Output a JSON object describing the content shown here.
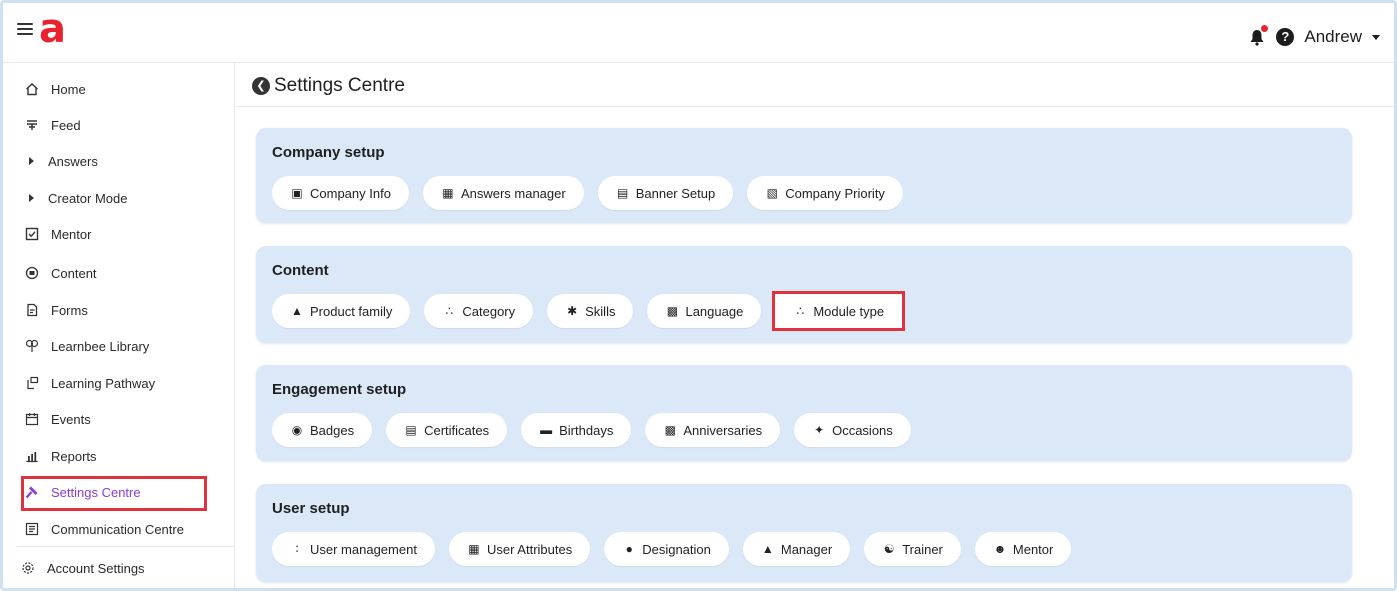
{
  "header": {
    "logo_text": "a",
    "user_name": "Andrew",
    "brand_color": "#e8232f"
  },
  "sidebar": {
    "items": [
      {
        "label": "Home",
        "icon": "home-icon"
      },
      {
        "label": "Feed",
        "icon": "feed-icon"
      },
      {
        "label": "Answers",
        "icon": "chevron-right-icon"
      },
      {
        "label": "Creator Mode",
        "icon": "chevron-right-icon"
      },
      {
        "label": "Mentor",
        "icon": "checkbox-icon"
      },
      {
        "label": "Content",
        "icon": "content-icon"
      },
      {
        "label": "Forms",
        "icon": "forms-icon"
      },
      {
        "label": "Learnbee Library",
        "icon": "library-icon"
      },
      {
        "label": "Learning Pathway",
        "icon": "pathway-icon"
      },
      {
        "label": "Events",
        "icon": "calendar-icon"
      },
      {
        "label": "Reports",
        "icon": "reports-icon"
      },
      {
        "label": "Settings Centre",
        "icon": "hammer-icon",
        "active": true
      },
      {
        "label": "Communication Centre",
        "icon": "communication-icon"
      },
      {
        "label": "Account Settings",
        "icon": "gear-icon"
      }
    ],
    "active_color": "#8a3dd6"
  },
  "page": {
    "back_icon": "back-arrow-icon",
    "title": "Settings Centre"
  },
  "sections": [
    {
      "title": "Company setup",
      "chips": [
        {
          "label": "Company Info",
          "icon": "monitor-icon"
        },
        {
          "label": "Answers manager",
          "icon": "grid-icon"
        },
        {
          "label": "Banner Setup",
          "icon": "banner-icon"
        },
        {
          "label": "Company Priority",
          "icon": "priority-icon"
        }
      ]
    },
    {
      "title": "Content",
      "chips": [
        {
          "label": "Product family",
          "icon": "hierarchy-icon"
        },
        {
          "label": "Category",
          "icon": "category-icon"
        },
        {
          "label": "Skills",
          "icon": "puzzle-icon"
        },
        {
          "label": "Language",
          "icon": "language-icon"
        },
        {
          "label": "Module type",
          "icon": "modules-icon",
          "highlight": true
        }
      ]
    },
    {
      "title": "Engagement setup",
      "chips": [
        {
          "label": "Badges",
          "icon": "badge-icon"
        },
        {
          "label": "Certificates",
          "icon": "certificate-icon"
        },
        {
          "label": "Birthdays",
          "icon": "cake-icon"
        },
        {
          "label": "Anniversaries",
          "icon": "gift-icon"
        },
        {
          "label": "Occasions",
          "icon": "party-icon"
        }
      ]
    },
    {
      "title": "User setup",
      "chips": [
        {
          "label": "User management",
          "icon": "users-icon"
        },
        {
          "label": "User Attributes",
          "icon": "attributes-icon"
        },
        {
          "label": "Designation",
          "icon": "designation-icon"
        },
        {
          "label": "Manager",
          "icon": "manager-icon"
        },
        {
          "label": "Trainer",
          "icon": "trainer-icon"
        },
        {
          "label": "Mentor",
          "icon": "mentor-icon"
        }
      ]
    }
  ],
  "highlight_color": "#e0323c"
}
